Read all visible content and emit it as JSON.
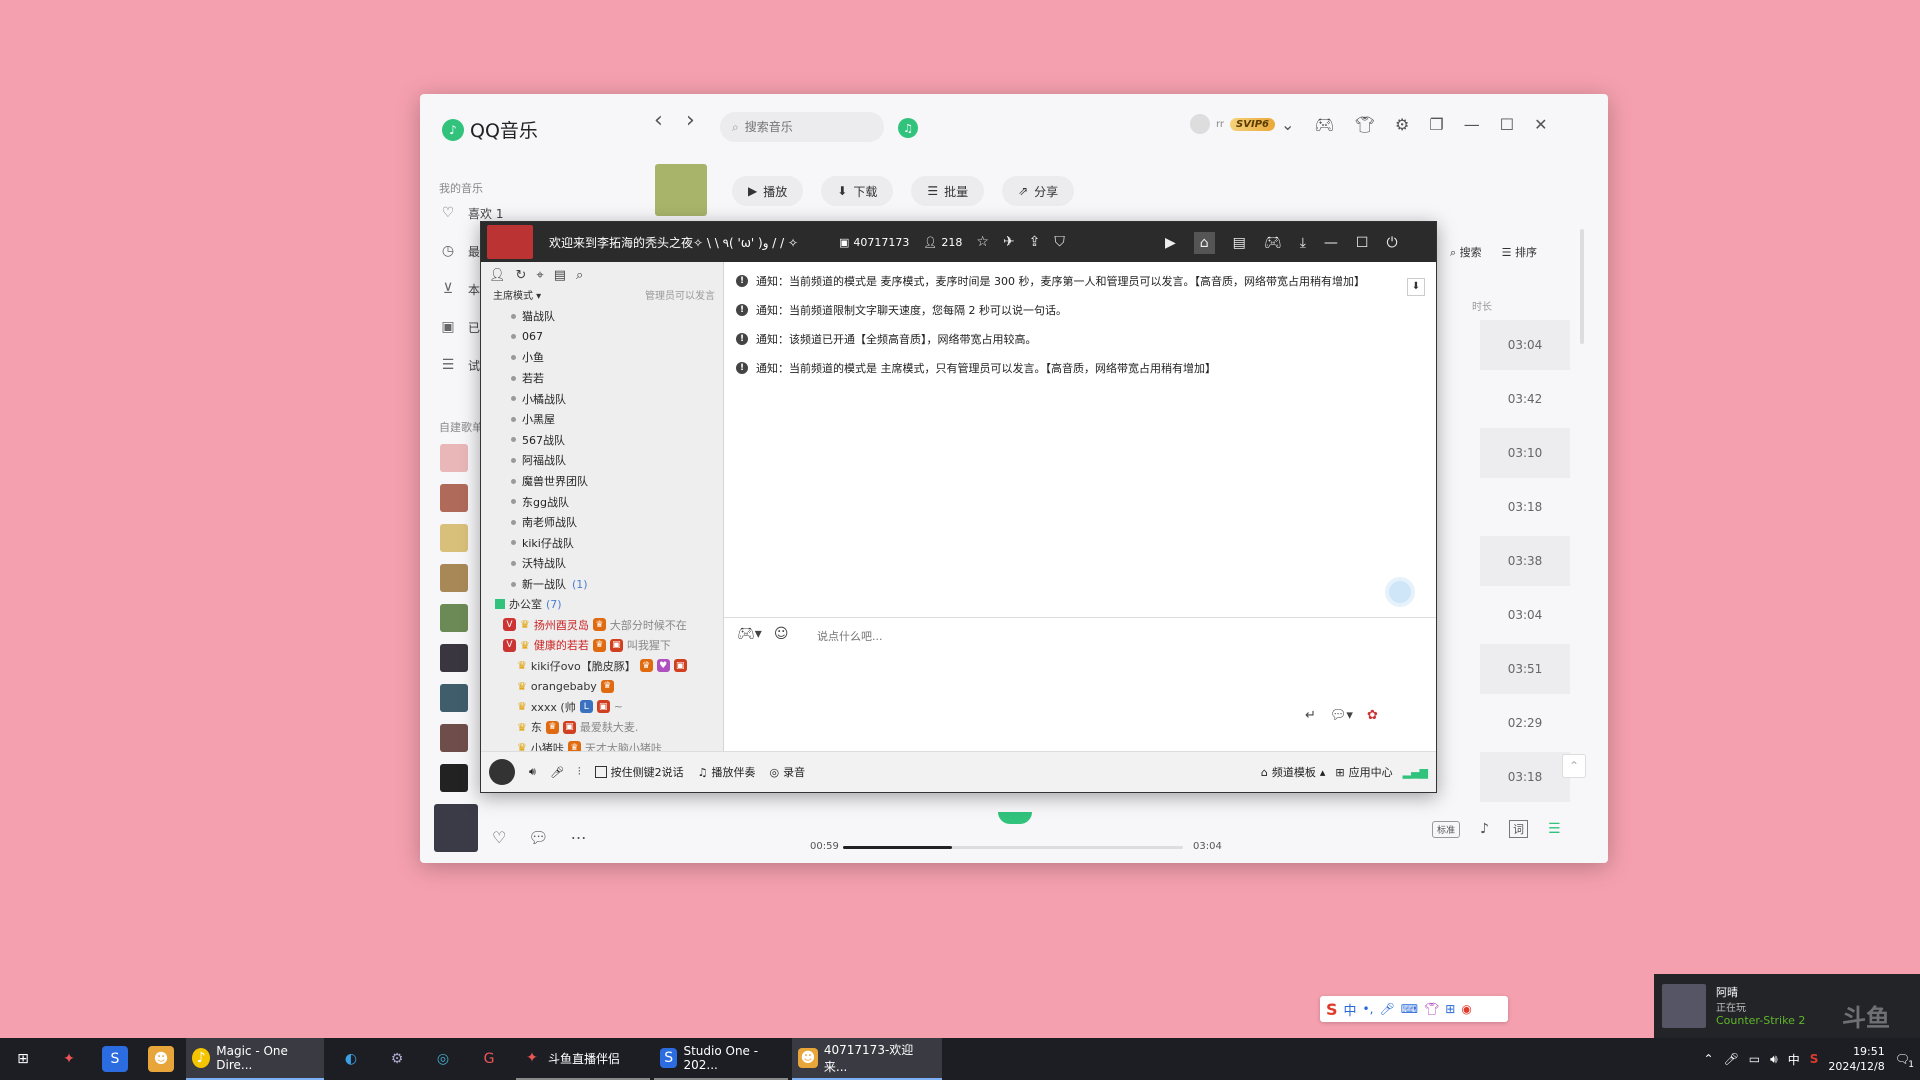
{
  "qq": {
    "brand": "QQ音乐",
    "search_placeholder": "搜索音乐",
    "username": "rr",
    "vip": "SVIP6",
    "sidebar_title": "我的音乐",
    "sidebar_items": [
      "喜欢 1",
      "最",
      "本",
      "已",
      "试"
    ],
    "playlist_title": "自建歌单",
    "actions": {
      "play": "播放",
      "download": "下载",
      "batch": "批量",
      "share": "分享"
    },
    "list_search": "搜索",
    "list_sort": "排序",
    "duration_header": "时长",
    "durations": [
      "03:04",
      "03:42",
      "03:10",
      "03:18",
      "03:38",
      "03:04",
      "03:51",
      "02:29",
      "03:18"
    ],
    "player": {
      "elapsed": "00:59",
      "total": "03:04",
      "progress": 0.32,
      "quality": "标准",
      "lyric": "词"
    }
  },
  "dy": {
    "title": "欢迎来到李拓海的秃头之夜✧ \\ \\ ٩( 'ω' )و / / ✧",
    "room_id": "40717173",
    "online_count": "218",
    "mode": "主席模式",
    "admin_note": "管理员可以发言",
    "channels": [
      "猫战队",
      "067",
      "小鱼",
      "若若",
      "小橘战队",
      "小黑屋",
      "567战队",
      "阿福战队",
      "魔兽世界团队",
      "东gg战队",
      "南老师战队",
      "kiki仔战队",
      "沃特战队",
      "新一战队"
    ],
    "channel_last_count": "(1)",
    "office": "办公室",
    "office_count": "(7)",
    "users": [
      {
        "name": "扬州酉灵岛",
        "note": "大部分时候不在"
      },
      {
        "name": "健康的若若",
        "note": "叫我猩下"
      },
      {
        "name": "kiki仔ovo【脆皮豚】",
        "note": ""
      },
      {
        "name": "orangebaby",
        "note": ""
      },
      {
        "name": "xxxx (帅",
        "note": "~"
      },
      {
        "name": "东",
        "note": "最爱麸大麦."
      },
      {
        "name": "小猪咔",
        "note": "天才大脑小猪咔"
      }
    ],
    "notices": [
      "通知：当前频道的模式是 麦序模式，麦序时间是 300 秒，麦序第一人和管理员可以发言。【高音质，网络带宽占用稍有增加】",
      "通知：当前频道限制文字聊天速度，您每隔 2 秒可以说一句话。",
      "通知：该频道已开通【全频高音质】，网络带宽占用较高。",
      "通知：当前频道的模式是 主席模式，只有管理员可以发言。【高音质，网络带宽占用稍有增加】"
    ],
    "chat_placeholder": "说点什么吧...",
    "bottom": {
      "ptt": "按住侧键2说话",
      "accompany": "播放伴奏",
      "record": "录音",
      "template": "频道模板",
      "apps": "应用中心"
    }
  },
  "notification": {
    "name": "阿晴",
    "status": "正在玩",
    "game": "Counter-Strike 2",
    "watermark": "斗鱼"
  },
  "taskbar": {
    "apps": [
      {
        "label": "Magic - One Dire...",
        "state": "active"
      },
      {
        "label": "斗鱼直播伴侣",
        "state": "run"
      },
      {
        "label": "Studio One - 202...",
        "state": "run"
      },
      {
        "label": "40717173-欢迎来...",
        "state": "active"
      }
    ],
    "ime": "中",
    "time": "19:51",
    "date": "2024/12/8",
    "notif_count": "1"
  },
  "ime_bar": {
    "lang": "中"
  },
  "colors": {
    "desktop": "#f5a0ae",
    "qq_green": "#31c27c",
    "taskbar": "#1d1e24"
  }
}
